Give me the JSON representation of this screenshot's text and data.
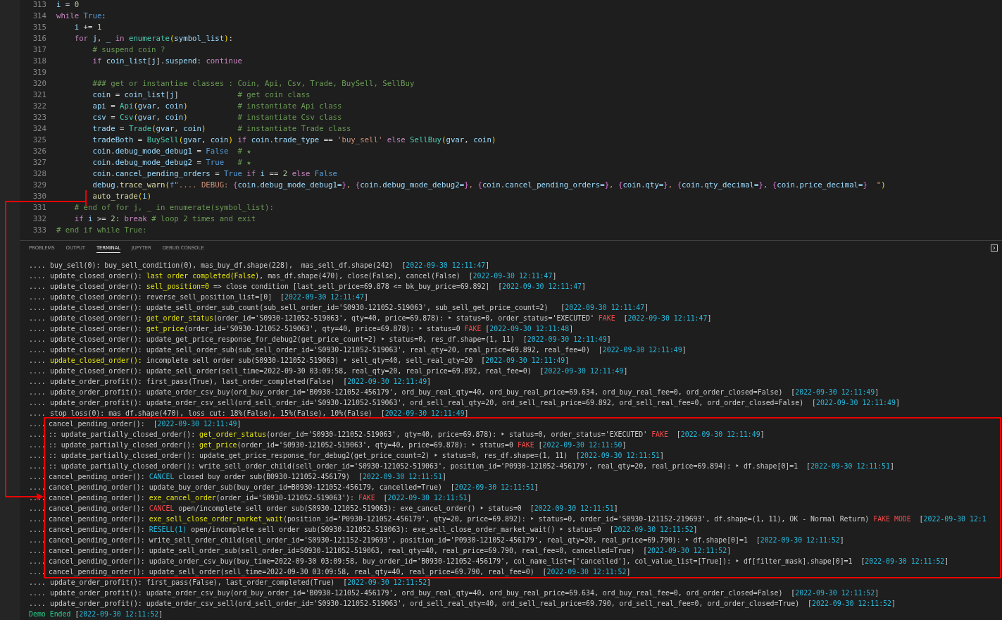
{
  "editor": {
    "lines": [
      {
        "number": "313",
        "segments": [
          {
            "kind": "var",
            "text": "i"
          },
          {
            "kind": "plain",
            "text": " = "
          },
          {
            "kind": "number",
            "text": "0"
          }
        ]
      },
      {
        "number": "314",
        "segments": [
          {
            "kind": "keyword",
            "text": "while "
          },
          {
            "kind": "const",
            "text": "True"
          },
          {
            "kind": "plain",
            "text": ":"
          }
        ]
      },
      {
        "number": "315",
        "segments": [
          {
            "kind": "var",
            "text": "    i"
          },
          {
            "kind": "plain",
            "text": " += "
          },
          {
            "kind": "number",
            "text": "1"
          }
        ]
      },
      {
        "number": "316",
        "segments": [
          {
            "kind": "keyword",
            "text": "    for "
          },
          {
            "kind": "var",
            "text": "j"
          },
          {
            "kind": "plain",
            "text": ", "
          },
          {
            "kind": "var",
            "text": "_ "
          },
          {
            "kind": "keyword",
            "text": "in "
          },
          {
            "kind": "func",
            "text": "enumerate"
          },
          {
            "kind": "paren",
            "text": "("
          },
          {
            "kind": "var",
            "text": "symbol_list"
          },
          {
            "kind": "paren",
            "text": ")"
          },
          {
            "kind": "plain",
            "text": ":"
          }
        ]
      },
      {
        "number": "317",
        "segments": [
          {
            "kind": "comment",
            "text": "        # suspend coin ?"
          }
        ]
      },
      {
        "number": "318",
        "segments": [
          {
            "kind": "keyword",
            "text": "        if "
          },
          {
            "kind": "var",
            "text": "coin_list"
          },
          {
            "kind": "plain",
            "text": "["
          },
          {
            "kind": "var",
            "text": "j"
          },
          {
            "kind": "plain",
            "text": "]."
          },
          {
            "kind": "var",
            "text": "suspend"
          },
          {
            "kind": "plain",
            "text": ": "
          },
          {
            "kind": "keyword",
            "text": "continue"
          }
        ]
      },
      {
        "number": "319"
      },
      {
        "number": "320",
        "segments": [
          {
            "kind": "comment",
            "text": "        ### get or instantiae classes : Coin, Api, Csv, Trade, BuySell, SellBuy"
          }
        ]
      },
      {
        "number": "321",
        "segments": [
          {
            "kind": "var",
            "text": "        coin"
          },
          {
            "kind": "plain",
            "text": " = "
          },
          {
            "kind": "var",
            "text": "coin_list"
          },
          {
            "kind": "plain",
            "text": "["
          },
          {
            "kind": "var",
            "text": "j"
          },
          {
            "kind": "plain",
            "text": "]             "
          },
          {
            "kind": "comment",
            "text": "# get coin class"
          }
        ]
      },
      {
        "number": "322",
        "segments": [
          {
            "kind": "var",
            "text": "        api"
          },
          {
            "kind": "plain",
            "text": " = "
          },
          {
            "kind": "func",
            "text": "Api"
          },
          {
            "kind": "paren",
            "text": "("
          },
          {
            "kind": "var",
            "text": "gvar"
          },
          {
            "kind": "plain",
            "text": ", "
          },
          {
            "kind": "var",
            "text": "coin"
          },
          {
            "kind": "paren",
            "text": ")           "
          },
          {
            "kind": "comment",
            "text": "# instantiate Api class"
          }
        ]
      },
      {
        "number": "323",
        "segments": [
          {
            "kind": "var",
            "text": "        csv"
          },
          {
            "kind": "plain",
            "text": " = "
          },
          {
            "kind": "func",
            "text": "Csv"
          },
          {
            "kind": "paren",
            "text": "("
          },
          {
            "kind": "var",
            "text": "gvar"
          },
          {
            "kind": "plain",
            "text": ", "
          },
          {
            "kind": "var",
            "text": "coin"
          },
          {
            "kind": "paren",
            "text": ")           "
          },
          {
            "kind": "comment",
            "text": "# instantiate Csv class"
          }
        ]
      },
      {
        "number": "324",
        "segments": [
          {
            "kind": "var",
            "text": "        trade"
          },
          {
            "kind": "plain",
            "text": " = "
          },
          {
            "kind": "func",
            "text": "Trade"
          },
          {
            "kind": "paren",
            "text": "("
          },
          {
            "kind": "var",
            "text": "gvar"
          },
          {
            "kind": "plain",
            "text": ", "
          },
          {
            "kind": "var",
            "text": "coin"
          },
          {
            "kind": "paren",
            "text": ")       "
          },
          {
            "kind": "comment",
            "text": "# instantiate Trade class"
          }
        ]
      },
      {
        "number": "325",
        "segments": [
          {
            "kind": "var",
            "text": "        tradeBoth"
          },
          {
            "kind": "plain",
            "text": " = "
          },
          {
            "kind": "func",
            "text": "BuySell"
          },
          {
            "kind": "paren",
            "text": "("
          },
          {
            "kind": "var",
            "text": "gvar"
          },
          {
            "kind": "plain",
            "text": ", "
          },
          {
            "kind": "var",
            "text": "coin"
          },
          {
            "kind": "paren",
            "text": ") "
          },
          {
            "kind": "keyword",
            "text": "if "
          },
          {
            "kind": "var",
            "text": "coin"
          },
          {
            "kind": "plain",
            "text": "."
          },
          {
            "kind": "var",
            "text": "trade_type"
          },
          {
            "kind": "plain",
            "text": " == "
          },
          {
            "kind": "string",
            "text": "'buy_sell' "
          },
          {
            "kind": "keyword",
            "text": "else "
          },
          {
            "kind": "func",
            "text": "SellBuy"
          },
          {
            "kind": "paren",
            "text": "("
          },
          {
            "kind": "var",
            "text": "gvar"
          },
          {
            "kind": "plain",
            "text": ", "
          },
          {
            "kind": "var",
            "text": "coin"
          },
          {
            "kind": "paren",
            "text": ")"
          }
        ]
      },
      {
        "number": "326",
        "segments": [
          {
            "kind": "var",
            "text": "        coin"
          },
          {
            "kind": "plain",
            "text": "."
          },
          {
            "kind": "var",
            "text": "debug_mode_debug1"
          },
          {
            "kind": "plain",
            "text": " = "
          },
          {
            "kind": "const",
            "text": "False  "
          },
          {
            "kind": "comment",
            "text": "# ★"
          }
        ]
      },
      {
        "number": "327",
        "segments": [
          {
            "kind": "var",
            "text": "        coin"
          },
          {
            "kind": "plain",
            "text": "."
          },
          {
            "kind": "var",
            "text": "debug_mode_debug2"
          },
          {
            "kind": "plain",
            "text": " = "
          },
          {
            "kind": "const",
            "text": "True   "
          },
          {
            "kind": "comment",
            "text": "# ★"
          }
        ]
      },
      {
        "number": "328",
        "segments": [
          {
            "kind": "var",
            "text": "        coin"
          },
          {
            "kind": "plain",
            "text": "."
          },
          {
            "kind": "var",
            "text": "cancel_pending_orders"
          },
          {
            "kind": "plain",
            "text": " = "
          },
          {
            "kind": "const",
            "text": "True "
          },
          {
            "kind": "keyword",
            "text": "if "
          },
          {
            "kind": "var",
            "text": "i"
          },
          {
            "kind": "plain",
            "text": " == "
          },
          {
            "kind": "number",
            "text": "2 "
          },
          {
            "kind": "keyword",
            "text": "else "
          },
          {
            "kind": "const",
            "text": "False"
          }
        ]
      },
      {
        "number": "329",
        "segments": [
          {
            "kind": "var",
            "text": "        debug"
          },
          {
            "kind": "plain",
            "text": "."
          },
          {
            "kind": "func2",
            "text": "trace_warn"
          },
          {
            "kind": "paren",
            "text": "("
          },
          {
            "kind": "const",
            "text": "f"
          },
          {
            "kind": "string",
            "text": "\".... DEBUG: "
          },
          {
            "kind": "brace",
            "text": "{"
          },
          {
            "kind": "var",
            "text": "coin.debug_mode_debug1="
          },
          {
            "kind": "brace",
            "text": "}"
          },
          {
            "kind": "string",
            "text": ", "
          },
          {
            "kind": "brace",
            "text": "{"
          },
          {
            "kind": "var",
            "text": "coin.debug_mode_debug2="
          },
          {
            "kind": "brace",
            "text": "}"
          },
          {
            "kind": "string",
            "text": ", "
          },
          {
            "kind": "brace",
            "text": "{"
          },
          {
            "kind": "var",
            "text": "coin.cancel_pending_orders="
          },
          {
            "kind": "brace",
            "text": "}"
          },
          {
            "kind": "string",
            "text": ", "
          },
          {
            "kind": "brace",
            "text": "{"
          },
          {
            "kind": "var",
            "text": "coin.qty="
          },
          {
            "kind": "brace",
            "text": "}"
          },
          {
            "kind": "string",
            "text": ", "
          },
          {
            "kind": "brace",
            "text": "{"
          },
          {
            "kind": "var",
            "text": "coin.qty_decimal="
          },
          {
            "kind": "brace",
            "text": "}"
          },
          {
            "kind": "string",
            "text": ", "
          },
          {
            "kind": "brace",
            "text": "{"
          },
          {
            "kind": "var",
            "text": "coin.price_decimal="
          },
          {
            "kind": "brace",
            "text": "}"
          },
          {
            "kind": "string",
            "text": "  \""
          },
          {
            "kind": "paren",
            "text": ")"
          }
        ]
      },
      {
        "number": "330",
        "segments": [
          {
            "kind": "func2",
            "text": "        auto_trade"
          },
          {
            "kind": "paren",
            "text": "("
          },
          {
            "kind": "var",
            "text": "i"
          },
          {
            "kind": "paren",
            "text": ")"
          }
        ]
      },
      {
        "number": "331",
        "segments": [
          {
            "kind": "comment",
            "text": "    # end of for j, _ in enumerate(symbol_list):"
          }
        ]
      },
      {
        "number": "332",
        "segments": [
          {
            "kind": "keyword",
            "text": "    if "
          },
          {
            "kind": "var",
            "text": "i"
          },
          {
            "kind": "plain",
            "text": " >= "
          },
          {
            "kind": "number",
            "text": "2"
          },
          {
            "kind": "plain",
            "text": ": "
          },
          {
            "kind": "keyword",
            "text": "break "
          },
          {
            "kind": "comment",
            "text": "# loop 2 times and exit"
          }
        ]
      },
      {
        "number": "333",
        "segments": [
          {
            "kind": "comment",
            "text": "# end if while True:"
          }
        ]
      }
    ]
  },
  "terminal": {
    "tabs": [
      {
        "label": "PROBLEMS",
        "selected": false
      },
      {
        "label": "OUTPUT",
        "selected": false
      },
      {
        "label": "TERMINAL",
        "selected": true
      },
      {
        "label": "JUPYTER",
        "selected": false
      },
      {
        "label": "DEBUG CONSOLE",
        "selected": false
      }
    ],
    "sections": [
      {
        "kind": "plain",
        "lines": [
          {
            "prefix": "....",
            "segments": [
              {
                "kind": "plain",
                "text": "buy_sell(0): buy_sell_condition(0), mas_buy_df.shape(228),  mas_sell_df.shape(242)  ["
              },
              {
                "kind": "time",
                "text": "2022-09-30 12:11:47"
              },
              {
                "kind": "plain",
                "text": "]"
              }
            ]
          },
          {
            "prefix": "....",
            "segments": [
              {
                "kind": "plain",
                "text": "update_closed_order(): "
              },
              {
                "kind": "yellow",
                "text": "last order completed(False)"
              },
              {
                "kind": "plain",
                "text": ", mas_df.shape(470), close(False), cancel(False)  ["
              },
              {
                "kind": "time",
                "text": "2022-09-30 12:11:47"
              },
              {
                "kind": "plain",
                "text": "]"
              }
            ]
          },
          {
            "prefix": "....",
            "segments": [
              {
                "kind": "plain",
                "text": "update_closed_order(): "
              },
              {
                "kind": "yellow",
                "text": "sell_position=0"
              },
              {
                "kind": "plain",
                "text": " => close condition [last_sell_price=69.878 <= bk_buy_price=69.892]  ["
              },
              {
                "kind": "time",
                "text": "2022-09-30 12:11:47"
              },
              {
                "kind": "plain",
                "text": "]"
              }
            ]
          },
          {
            "prefix": "....",
            "segments": [
              {
                "kind": "plain",
                "text": "update_closed_order(): reverse_sell_position_list=[0]  ["
              },
              {
                "kind": "time",
                "text": "2022-09-30 12:11:47"
              },
              {
                "kind": "plain",
                "text": "]"
              }
            ]
          },
          {
            "prefix": "....",
            "segments": [
              {
                "kind": "plain",
                "text": "update_closed_order(): update_sell_order_sub_count(sub_sell_order_id='S0930-121052-519063', sub_sell_get_price_count=2)   ["
              },
              {
                "kind": "time",
                "text": "2022-09-30 12:11:47"
              },
              {
                "kind": "plain",
                "text": "]"
              }
            ]
          },
          {
            "prefix": "....",
            "segments": [
              {
                "kind": "plain",
                "text": "update_closed_order(): "
              },
              {
                "kind": "yellow",
                "text": "get_order_status"
              },
              {
                "kind": "plain",
                "text": "(order_id='S0930-121052-519063', qty=40, price=69.878): ‣ status=0, order_status='EXECUTED' "
              },
              {
                "kind": "red",
                "text": "FAKE"
              },
              {
                "kind": "plain",
                "text": "  ["
              },
              {
                "kind": "time",
                "text": "2022-09-30 12:11:47"
              },
              {
                "kind": "plain",
                "text": "]"
              }
            ]
          },
          {
            "prefix": "....",
            "segments": [
              {
                "kind": "plain",
                "text": "update_closed_order(): "
              },
              {
                "kind": "yellow",
                "text": "get_price"
              },
              {
                "kind": "plain",
                "text": "(order_id='S0930-121052-519063', qty=40, price=69.878): ‣ status=0 "
              },
              {
                "kind": "red",
                "text": "FAKE"
              },
              {
                "kind": "plain",
                "text": " ["
              },
              {
                "kind": "time",
                "text": "2022-09-30 12:11:48"
              },
              {
                "kind": "plain",
                "text": "]"
              }
            ]
          },
          {
            "prefix": "....",
            "segments": [
              {
                "kind": "plain",
                "text": "update_closed_order(): update_get_price_response_for_debug2(get_price_count=2) ‣ status=0, res_df.shape=(1, 11)  ["
              },
              {
                "kind": "time",
                "text": "2022-09-30 12:11:49"
              },
              {
                "kind": "plain",
                "text": "]"
              }
            ]
          },
          {
            "prefix": "....",
            "segments": [
              {
                "kind": "plain",
                "text": "update_closed_order(): update_sell_order_sub(sub_sell_order_id='S0930-121052-519063', real_qty=20, real_price=69.892, real_fee=0)  ["
              },
              {
                "kind": "time",
                "text": "2022-09-30 12:11:49"
              },
              {
                "kind": "plain",
                "text": "]"
              }
            ]
          },
          {
            "prefix": "....",
            "segments": [
              {
                "kind": "yellow",
                "text": "update_closed_order():"
              },
              {
                "kind": "plain",
                "text": " incomplete sell order sub(S0930-121052-519063) ‣ sell_qty=40, sell_real_qty=20  ["
              },
              {
                "kind": "time",
                "text": "2022-09-30 12:11:49"
              },
              {
                "kind": "plain",
                "text": "]"
              }
            ]
          },
          {
            "prefix": "....",
            "segments": [
              {
                "kind": "plain",
                "text": "update_closed_order(): update_sell_order(sell_time=2022-09-30 03:09:58, real_qty=20, real_price=69.892, real_fee=0)  ["
              },
              {
                "kind": "time",
                "text": "2022-09-30 12:11:49"
              },
              {
                "kind": "plain",
                "text": "]"
              }
            ]
          },
          {
            "prefix": "....",
            "segments": [
              {
                "kind": "plain",
                "text": "update_order_profit(): first_pass(True), last_order_completed(False)  ["
              },
              {
                "kind": "time",
                "text": "2022-09-30 12:11:49"
              },
              {
                "kind": "plain",
                "text": "]"
              }
            ]
          },
          {
            "prefix": "....",
            "segments": [
              {
                "kind": "plain",
                "text": "update_order_profit(): update_order_csv_buy(ord_buy_order_id='B0930-121052-456179', ord_buy_real_qty=40, ord_buy_real_price=69.634, ord_buy_real_fee=0, ord_order_closed=False)  ["
              },
              {
                "kind": "time",
                "text": "2022-09-30 12:11:49"
              },
              {
                "kind": "plain",
                "text": "]"
              }
            ]
          },
          {
            "prefix": "....",
            "segments": [
              {
                "kind": "plain",
                "text": "update_order_profit(): update_order_csv_sell(ord_sell_order_id='S0930-121052-519063', ord_sell_real_qty=20, ord_sell_real_price=69.892, ord_sell_real_fee=0, ord_order_closed=False)  ["
              },
              {
                "kind": "time",
                "text": "2022-09-30 12:11:49"
              },
              {
                "kind": "plain",
                "text": "]"
              }
            ]
          },
          {
            "prefix": "....",
            "segments": [
              {
                "kind": "plain",
                "text": "stop_loss(0): mas_df.shape(470), loss cut: 18%(False), 15%(False), 10%(False)  ["
              },
              {
                "kind": "time",
                "text": "2022-09-30 12:11:49"
              },
              {
                "kind": "plain",
                "text": "]"
              }
            ]
          }
        ]
      },
      {
        "kind": "highlight",
        "lines": [
          {
            "prefix": "....",
            "segments": [
              {
                "kind": "plain",
                "text": "cancel_pending_order():  ["
              },
              {
                "kind": "time",
                "text": "2022-09-30 12:11:49"
              },
              {
                "kind": "plain",
                "text": "]"
              }
            ]
          },
          {
            "prefix": "....",
            "segments": [
              {
                "kind": "plain",
                "text": ":: update_partially_closed_order(): "
              },
              {
                "kind": "yellow",
                "text": "get_order_status"
              },
              {
                "kind": "plain",
                "text": "(order_id='S0930-121052-519063', qty=40, price=69.878): ‣ status=0, order_status='EXECUTED' "
              },
              {
                "kind": "red",
                "text": "FAKE"
              },
              {
                "kind": "plain",
                "text": "  ["
              },
              {
                "kind": "time",
                "text": "2022-09-30 12:11:49"
              },
              {
                "kind": "plain",
                "text": "]"
              }
            ]
          },
          {
            "prefix": "....",
            "segments": [
              {
                "kind": "plain",
                "text": ":: update_partially_closed_order(): "
              },
              {
                "kind": "yellow",
                "text": "get_price"
              },
              {
                "kind": "plain",
                "text": "(order_id='S0930-121052-519063', qty=40, price=69.878): ‣ status=0 "
              },
              {
                "kind": "red",
                "text": "FAKE"
              },
              {
                "kind": "plain",
                "text": " ["
              },
              {
                "kind": "time",
                "text": "2022-09-30 12:11:50"
              },
              {
                "kind": "plain",
                "text": "]"
              }
            ]
          },
          {
            "prefix": "....",
            "segments": [
              {
                "kind": "plain",
                "text": ":: update_partially_closed_order(): update_get_price_response_for_debug2(get_price_count=2) ‣ status=0, res_df.shape=(1, 11)  ["
              },
              {
                "kind": "time",
                "text": "2022-09-30 12:11:51"
              },
              {
                "kind": "plain",
                "text": "]"
              }
            ]
          },
          {
            "prefix": "....",
            "segments": [
              {
                "kind": "plain",
                "text": ":: update_partially_closed_order(): write_sell_order_child(sell_order_id='S0930-121052-519063', position_id='P0930-121052-456179', real_qty=20, real_price=69.894): ‣ df.shape[0]=1  ["
              },
              {
                "kind": "time",
                "text": "2022-09-30 12:11:51"
              },
              {
                "kind": "plain",
                "text": "]"
              }
            ]
          },
          {
            "prefix": "....",
            "segments": [
              {
                "kind": "plain",
                "text": "cancel_pending_order(): "
              },
              {
                "kind": "cyan",
                "text": "CANCEL"
              },
              {
                "kind": "plain",
                "text": " closed buy order sub(B0930-121052-456179)  ["
              },
              {
                "kind": "time",
                "text": "2022-09-30 12:11:51"
              },
              {
                "kind": "plain",
                "text": "]"
              }
            ]
          },
          {
            "prefix": "....",
            "segments": [
              {
                "kind": "plain",
                "text": "cancel_pending_order(): update_buy_order_sub(buy_order_id=B0930-121052-456179, cancelled=True)  ["
              },
              {
                "kind": "time",
                "text": "2022-09-30 12:11:51"
              },
              {
                "kind": "plain",
                "text": "]"
              }
            ]
          },
          {
            "prefix": "....",
            "segments": [
              {
                "kind": "plain",
                "text": "cancel_pending_order(): "
              },
              {
                "kind": "yellow",
                "text": "exe_cancel_order"
              },
              {
                "kind": "plain",
                "text": "(order_id='S0930-121052-519063'): "
              },
              {
                "kind": "red",
                "text": "FAKE"
              },
              {
                "kind": "plain",
                "text": "  ["
              },
              {
                "kind": "time",
                "text": "2022-09-30 12:11:51"
              },
              {
                "kind": "plain",
                "text": "]"
              }
            ]
          },
          {
            "prefix": "....",
            "segments": [
              {
                "kind": "plain",
                "text": "cancel_pending_order(): "
              },
              {
                "kind": "red",
                "text": "CANCEL"
              },
              {
                "kind": "plain",
                "text": " open/incomplete sell order sub(S0930-121052-519063): exe_cancel_order() ‣ status=0  ["
              },
              {
                "kind": "time",
                "text": "2022-09-30 12:11:51"
              },
              {
                "kind": "plain",
                "text": "]"
              }
            ]
          },
          {
            "prefix": "....",
            "segments": [
              {
                "kind": "plain",
                "text": "cancel_pending_order(): "
              },
              {
                "kind": "yellow",
                "text": "exe_sell_close_order_market_wait"
              },
              {
                "kind": "plain",
                "text": "(position_id='P0930-121052-456179', qty=20, price=69.892): ‣ status=0, order_id='S0930-121152-219693', df.shape=(1, 11), OK - Normal Return) "
              },
              {
                "kind": "red",
                "text": "FAKE MODE"
              },
              {
                "kind": "plain",
                "text": "  ["
              },
              {
                "kind": "time",
                "text": "2022-09-30 12:1"
              }
            ]
          },
          {
            "prefix": "....",
            "segments": [
              {
                "kind": "plain",
                "text": "cancel_pending_order(): "
              },
              {
                "kind": "cyan",
                "text": "RESELL(1)"
              },
              {
                "kind": "plain",
                "text": " open/incomplete sell order sub(S0930-121052-519063): exe_sell_close_order_market_wait() ‣ status=0  ["
              },
              {
                "kind": "time",
                "text": "2022-09-30 12:11:52"
              },
              {
                "kind": "plain",
                "text": "]"
              }
            ]
          },
          {
            "prefix": "....",
            "segments": [
              {
                "kind": "plain",
                "text": "cancel_pending_order(): write_sell_order_child(sell_order_id='S0930-121152-219693', position_id='P0930-121052-456179', real_qty=20, real_price=69.790): ‣ df.shape[0]=1  ["
              },
              {
                "kind": "time",
                "text": "2022-09-30 12:11:52"
              },
              {
                "kind": "plain",
                "text": "]"
              }
            ]
          },
          {
            "prefix": "....",
            "segments": [
              {
                "kind": "plain",
                "text": "cancel_pending_order(): update_sell_order_sub(sell_order_id=S0930-121052-519063, real_qty=40, real_price=69.790, real_fee=0, cancelled=True)  ["
              },
              {
                "kind": "time",
                "text": "2022-09-30 12:11:52"
              },
              {
                "kind": "plain",
                "text": "]"
              }
            ]
          },
          {
            "prefix": "....",
            "segments": [
              {
                "kind": "plain",
                "text": "cancel_pending_order(): update_order_csv_buy(buy_time=2022-09-30 03:09:58, buy_order_id='B0930-121052-456179', col_name_list=['cancelled'], col_value_list=[True]): ‣ df[filter_mask].shape[0]=1  ["
              },
              {
                "kind": "time",
                "text": "2022-09-30 12:11:52"
              },
              {
                "kind": "plain",
                "text": "]"
              }
            ]
          },
          {
            "prefix": "....",
            "segments": [
              {
                "kind": "plain",
                "text": "cancel_pending_order(): update_sell_order(sell_time=2022-09-30 03:09:58, real_qty=40, real_price=69.790, real_fee=0)  ["
              },
              {
                "kind": "time",
                "text": "2022-09-30 12:11:52"
              },
              {
                "kind": "plain",
                "text": "]"
              }
            ]
          }
        ]
      },
      {
        "kind": "plain",
        "lines": [
          {
            "prefix": "....",
            "segments": [
              {
                "kind": "plain",
                "text": "update_order_profit(): first_pass(False), last_order_completed(True)  ["
              },
              {
                "kind": "time",
                "text": "2022-09-30 12:11:52"
              },
              {
                "kind": "plain",
                "text": "]"
              }
            ]
          },
          {
            "prefix": "....",
            "segments": [
              {
                "kind": "plain",
                "text": "update_order_profit(): update_order_csv_buy(ord_buy_order_id='B0930-121052-456179', ord_buy_real_qty=40, ord_buy_real_price=69.634, ord_buy_real_fee=0, ord_order_closed=False)  ["
              },
              {
                "kind": "time",
                "text": "2022-09-30 12:11:52"
              },
              {
                "kind": "plain",
                "text": "]"
              }
            ]
          },
          {
            "prefix": "....",
            "segments": [
              {
                "kind": "plain",
                "text": "update_order_profit(): update_order_csv_sell(ord_sell_order_id='S0930-121052-519063', ord_sell_real_qty=40, ord_sell_real_price=69.790, ord_sell_real_fee=0, ord_order_closed=True)  ["
              },
              {
                "kind": "time",
                "text": "2022-09-30 12:11:52"
              },
              {
                "kind": "plain",
                "text": "]"
              }
            ]
          },
          {
            "segments": [
              {
                "kind": "green",
                "text": "Demo Ended"
              },
              {
                "kind": "plain",
                "text": " ["
              },
              {
                "kind": "time",
                "text": "2022-09-30 12:11:52"
              },
              {
                "kind": "plain",
                "text": "]"
              }
            ]
          }
        ]
      }
    ]
  }
}
